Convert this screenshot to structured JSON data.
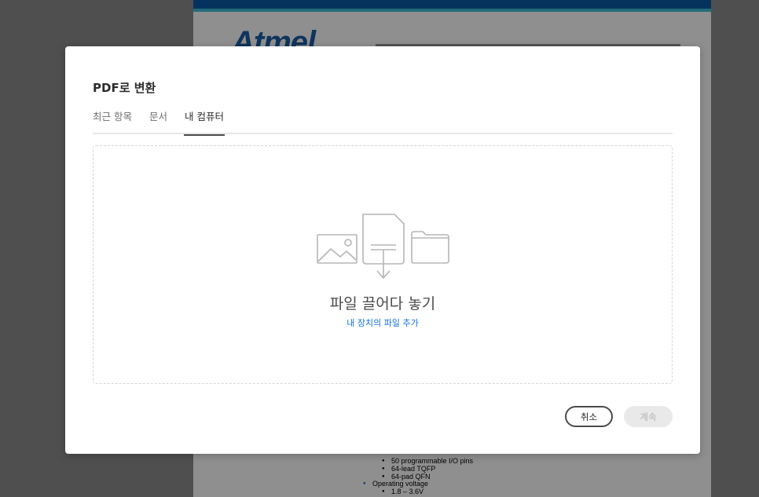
{
  "background_document": {
    "logo_text": "Atmel",
    "bullets": [
      {
        "text": "50 programmable I/O pins",
        "level": 1
      },
      {
        "text": "64-lead TQFP",
        "level": 1
      },
      {
        "text": "64-pad QFN",
        "level": 1
      },
      {
        "text": "Operating voltage",
        "level": 0
      },
      {
        "text": "1.8 – 3.6V",
        "level": 1
      }
    ]
  },
  "modal": {
    "title": "PDF로 변환",
    "tabs": [
      {
        "label": "최근 항목",
        "active": false
      },
      {
        "label": "문서",
        "active": false
      },
      {
        "label": "내 컴퓨터",
        "active": true
      }
    ],
    "dropzone": {
      "label": "파일 끌어다 놓기",
      "link": "내 장치의 파일 추가",
      "icons": [
        "image-icon",
        "document-download-icon",
        "folder-icon"
      ]
    },
    "buttons": {
      "cancel": "취소",
      "continue": "계속"
    }
  },
  "colors": {
    "link": "#1473e6",
    "brand_blue": "#0a5ca8",
    "brand_cyan": "#3fc0d8"
  }
}
